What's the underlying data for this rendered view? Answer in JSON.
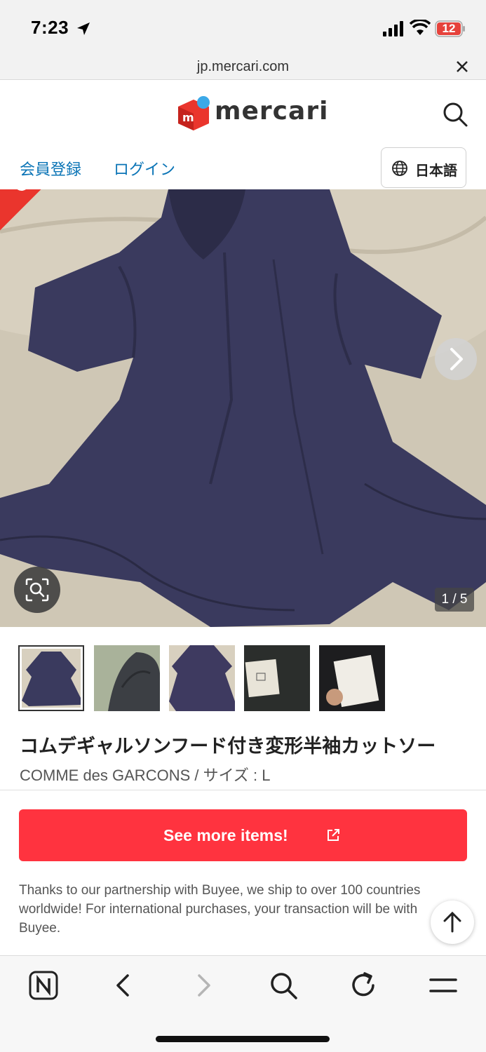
{
  "status_bar": {
    "time": "7:23",
    "battery": "12",
    "icons": [
      "location-arrow-icon",
      "cellular-signal-icon",
      "wifi-icon",
      "battery-icon"
    ]
  },
  "url_bar": {
    "domain": "jp.mercari.com",
    "close_icon": "close-icon"
  },
  "header": {
    "logo_text": "mercari",
    "logo_mark": "m",
    "search_icon": "search-icon",
    "brand_color": "#ea352d",
    "accent_dot": "#3ca9e8"
  },
  "auth": {
    "register_label": "会員登録",
    "login_label": "ログイン",
    "language_label": "日本語",
    "language_icon": "globe-icon"
  },
  "gallery": {
    "sold_label": "SOLD",
    "counter": "1 / 5",
    "next_icon": "chevron-right-icon",
    "lens_icon": "image-search-icon",
    "thumbnail_count": 5
  },
  "item": {
    "title": "コムデギャルソンフード付き変形半袖カットソー",
    "meta": "COMME des GARCONS / サイズ : L"
  },
  "cta": {
    "label": "See more items!",
    "icon": "external-link-icon",
    "color": "#ff333f"
  },
  "notice": "Thanks to our partnership with Buyee, we ship to over 100 countries worldwide! For international purchases, your transaction will be with Buyee.",
  "scroll_top_icon": "arrow-up-icon",
  "toolbar": {
    "items": [
      "n-app-icon",
      "back-icon",
      "forward-icon",
      "search-icon",
      "reload-icon",
      "menu-icon"
    ]
  }
}
